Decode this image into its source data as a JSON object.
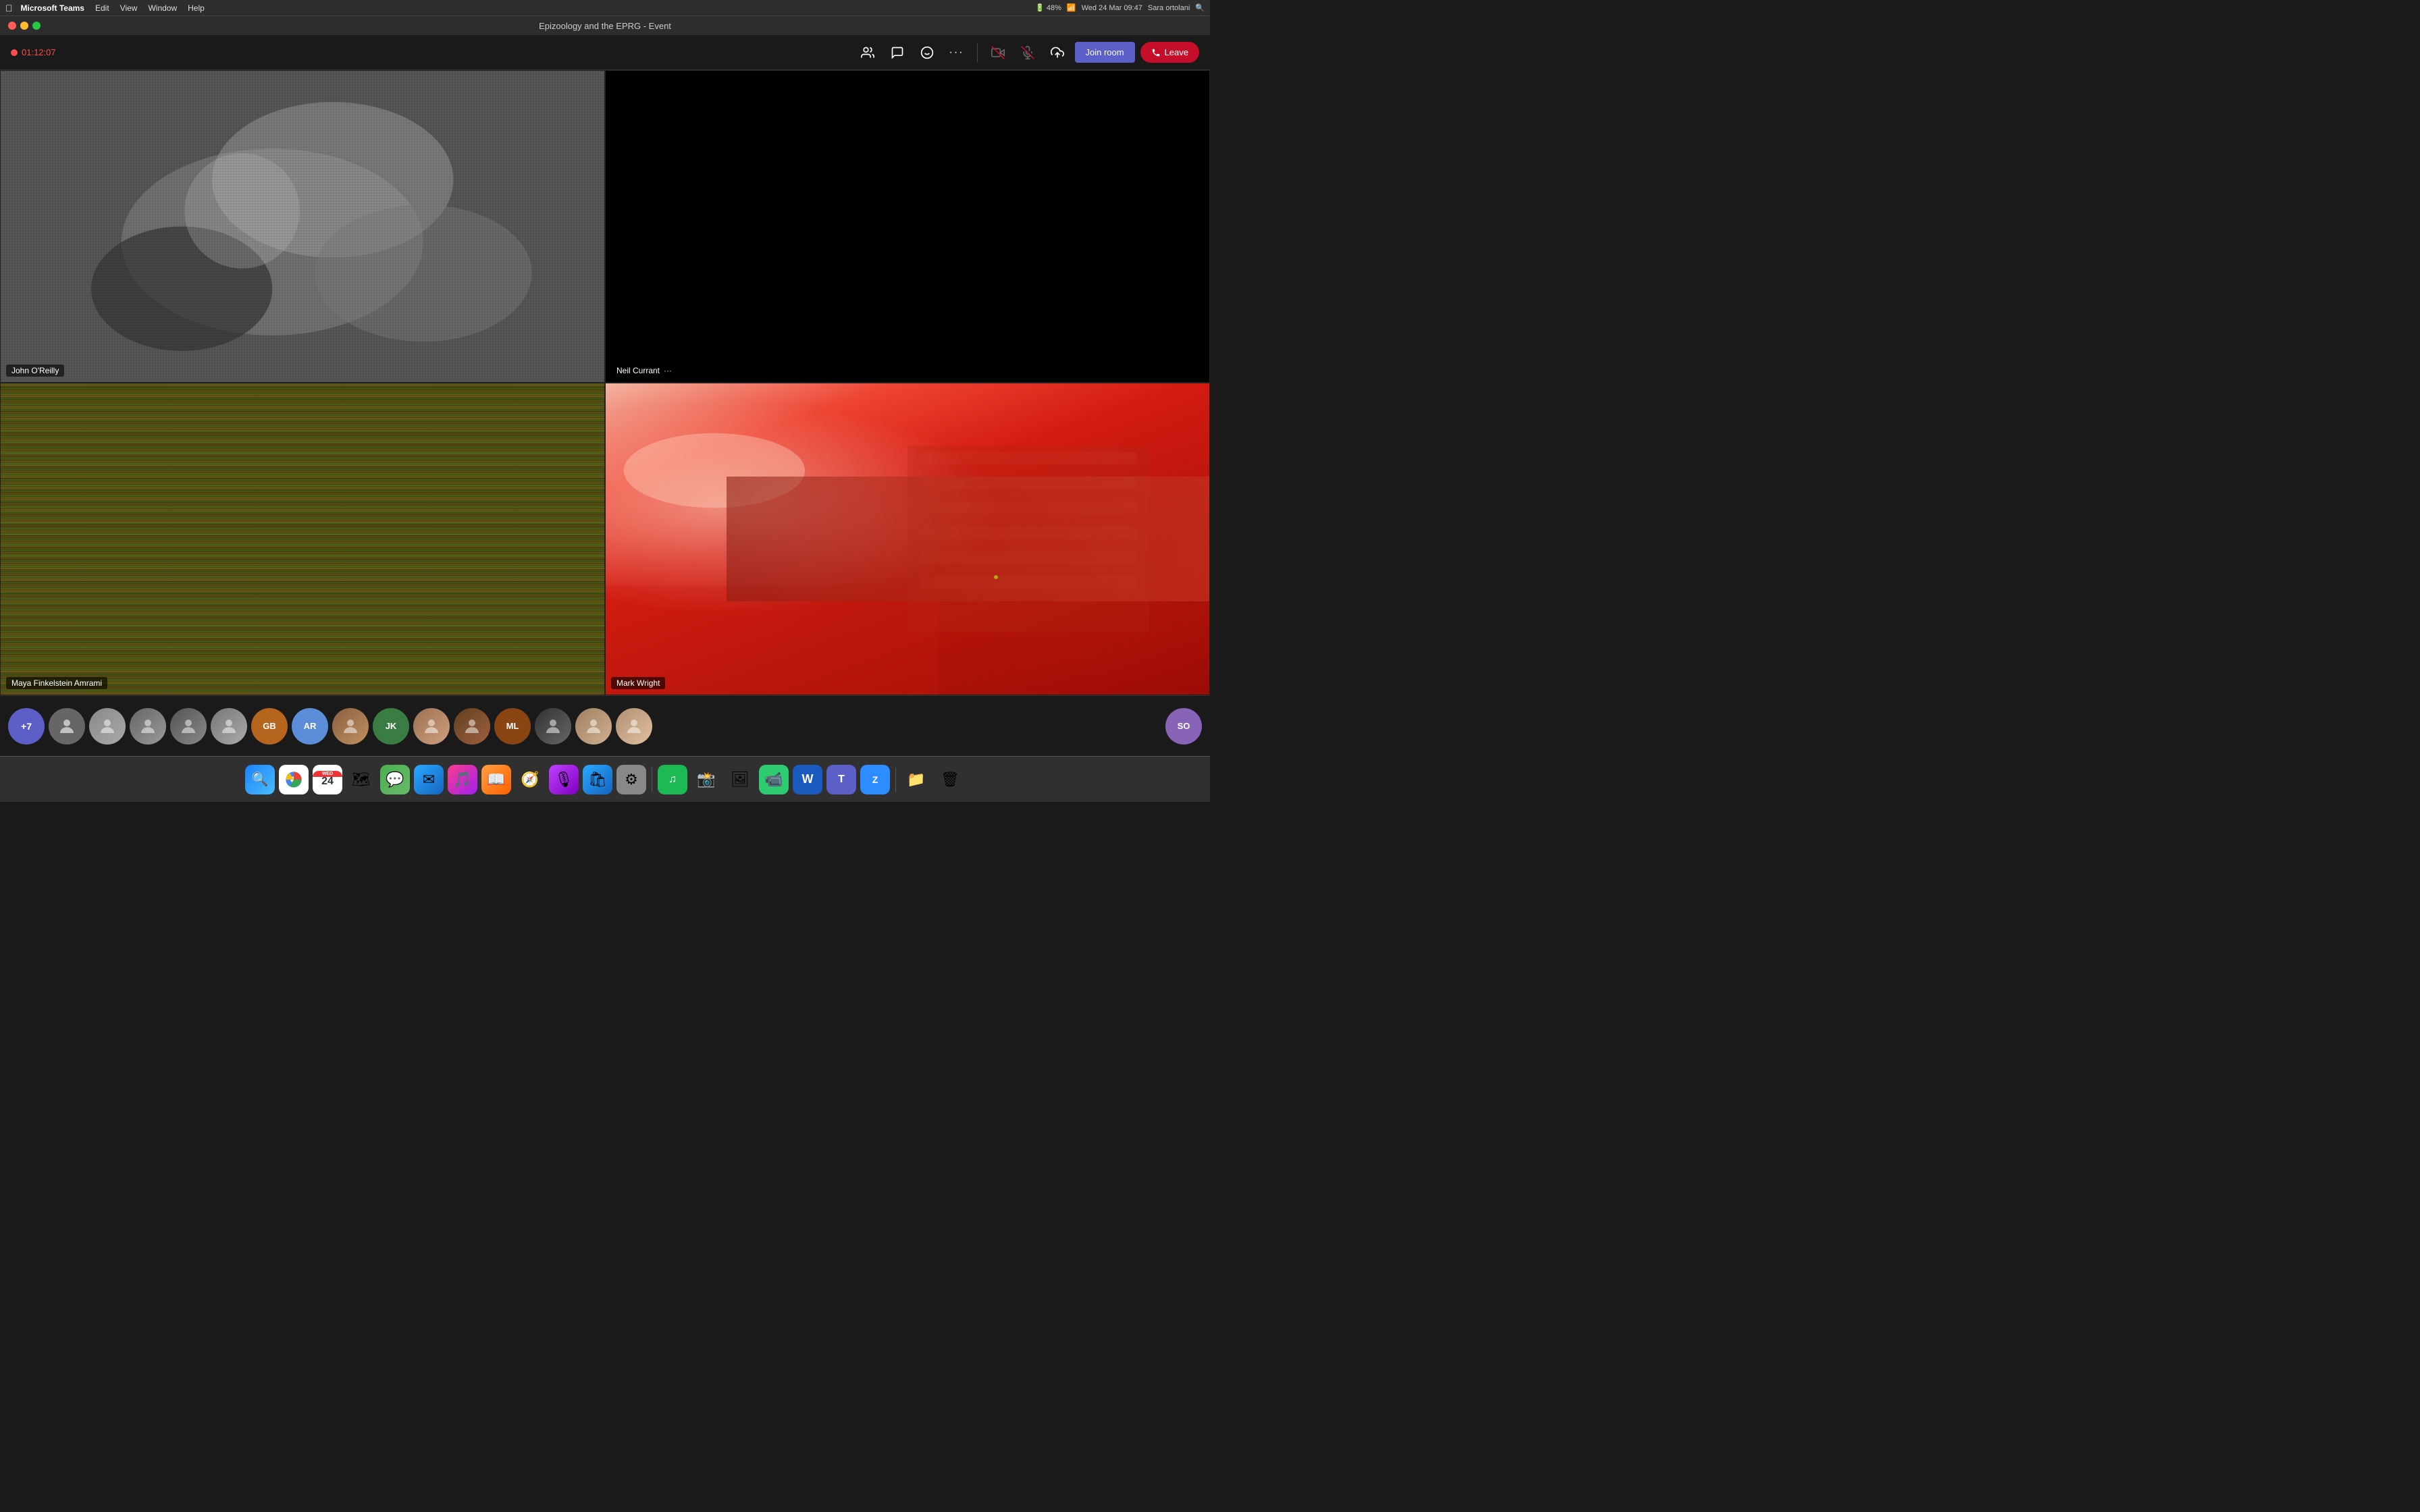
{
  "window": {
    "title": "Epizoology and the EPRG - Event"
  },
  "mac_menubar": {
    "apple": "⌘",
    "app_name": "Microsoft Teams",
    "menus": [
      "Edit",
      "View",
      "Window",
      "Help"
    ],
    "time": "Wed 24 Mar  09:47",
    "user": "Sara ortolani",
    "battery": "48%"
  },
  "toolbar": {
    "recording_time": "01:12:07",
    "join_room_label": "Join room",
    "leave_label": "Leave"
  },
  "video_cells": [
    {
      "id": "cell1",
      "participant": "John O'Reilly",
      "type": "grayscale_video"
    },
    {
      "id": "cell2",
      "participant": "Neil Currant",
      "label_extra": "···",
      "type": "black"
    },
    {
      "id": "cell3",
      "participant": "Maya Finkelstein Amrami",
      "type": "glitch"
    },
    {
      "id": "cell4",
      "participant": "Mark Wright",
      "type": "red_room"
    }
  ],
  "participants_strip": {
    "more_count": "+7",
    "initials": [
      "GB",
      "AR",
      "JK",
      "ML"
    ],
    "self_initials": "SO"
  },
  "dock": {
    "items": [
      {
        "name": "finder",
        "symbol": "🔍"
      },
      {
        "name": "chrome",
        "symbol": "🌐"
      },
      {
        "name": "calendar",
        "symbol": "📅"
      },
      {
        "name": "maps",
        "symbol": "🗺"
      },
      {
        "name": "messages",
        "symbol": "💬"
      },
      {
        "name": "mail",
        "symbol": "✉"
      },
      {
        "name": "music",
        "symbol": "🎵"
      },
      {
        "name": "books",
        "symbol": "📖"
      },
      {
        "name": "safari",
        "symbol": "🧭"
      },
      {
        "name": "podcasts",
        "symbol": "🎙"
      },
      {
        "name": "appstore",
        "symbol": "🛍"
      },
      {
        "name": "settings",
        "symbol": "⚙"
      },
      {
        "name": "spotify",
        "symbol": "🎵"
      },
      {
        "name": "photos",
        "symbol": "📸"
      },
      {
        "name": "photos2",
        "symbol": "🖼"
      },
      {
        "name": "facetime",
        "symbol": "📹"
      },
      {
        "name": "word",
        "symbol": "W"
      },
      {
        "name": "teams",
        "symbol": "T"
      },
      {
        "name": "zoom",
        "symbol": "Z"
      },
      {
        "name": "finder2",
        "symbol": "📁"
      },
      {
        "name": "trash",
        "symbol": "🗑"
      }
    ]
  }
}
